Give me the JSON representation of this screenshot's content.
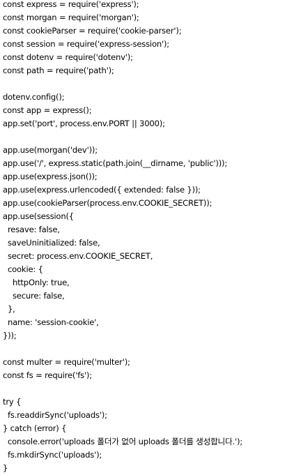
{
  "code": {
    "lines": [
      "const express = require('express');",
      "const morgan = require('morgan');",
      "const cookieParser = require('cookie-parser');",
      "const session = require('express-session');",
      "const dotenv = require('dotenv');",
      "const path = require('path');",
      "",
      "dotenv.config();",
      "const app = express();",
      "app.set('port', process.env.PORT || 3000);",
      "",
      "app.use(morgan('dev'));",
      "app.use('/', express.static(path.join(__dirname, 'public')));",
      "app.use(express.json());",
      "app.use(express.urlencoded({ extended: false }));",
      "app.use(cookieParser(process.env.COOKIE_SECRET));",
      "app.use(session({",
      "  resave: false,",
      "  saveUninitialized: false,",
      "  secret: process.env.COOKIE_SECRET,",
      "  cookie: {",
      "    httpOnly: true,",
      "    secure: false,",
      "  },",
      "  name: 'session-cookie',",
      "}));",
      "",
      "const multer = require('multer');",
      "const fs = require('fs');",
      "",
      "try {",
      "  fs.readdirSync('uploads');",
      "} catch (error) {",
      "  console.error('uploads 폴더가 없어 uploads 폴더를 생성합니다.');",
      "  fs.mkdirSync('uploads');",
      "}"
    ]
  }
}
